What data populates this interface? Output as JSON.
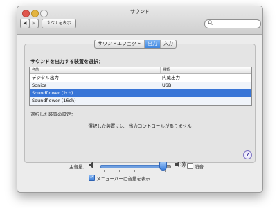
{
  "window": {
    "title": "サウンド"
  },
  "toolbar": {
    "back_glyph": "◀",
    "forward_glyph": "▶",
    "show_all_label": "すべてを表示",
    "search_icon": "magnifier"
  },
  "tabs": [
    {
      "label": "サウンドエフェクト",
      "selected": false
    },
    {
      "label": "出力",
      "selected": true
    },
    {
      "label": "入力",
      "selected": false
    }
  ],
  "output": {
    "heading": "サウンドを出力する装置を選択：",
    "columns": {
      "name": "名前",
      "type": "種類"
    },
    "devices": [
      {
        "name": "デジタル出力",
        "type": "内蔵出力",
        "selected": false
      },
      {
        "name": "Sonica",
        "type": "USB",
        "selected": false
      },
      {
        "name": "Soundflower (2ch)",
        "type": "",
        "selected": true
      },
      {
        "name": "Soundflower (16ch)",
        "type": "",
        "selected": false
      }
    ],
    "settings_label": "選択した装置の設定：",
    "no_controls_message": "選択した装置には、出力コントロールがありません"
  },
  "help": {
    "label": "?"
  },
  "volume": {
    "label": "主音量：",
    "level": 0.9,
    "low_icon": "speaker-low",
    "high_icon": "speaker-high",
    "mute_label": "消音",
    "mute_checked": false,
    "menubar_label": "メニューバーに音量を表示",
    "menubar_checked": true
  },
  "colors": {
    "selection": "#3875d7",
    "tab_selected": "#3f87e0"
  }
}
